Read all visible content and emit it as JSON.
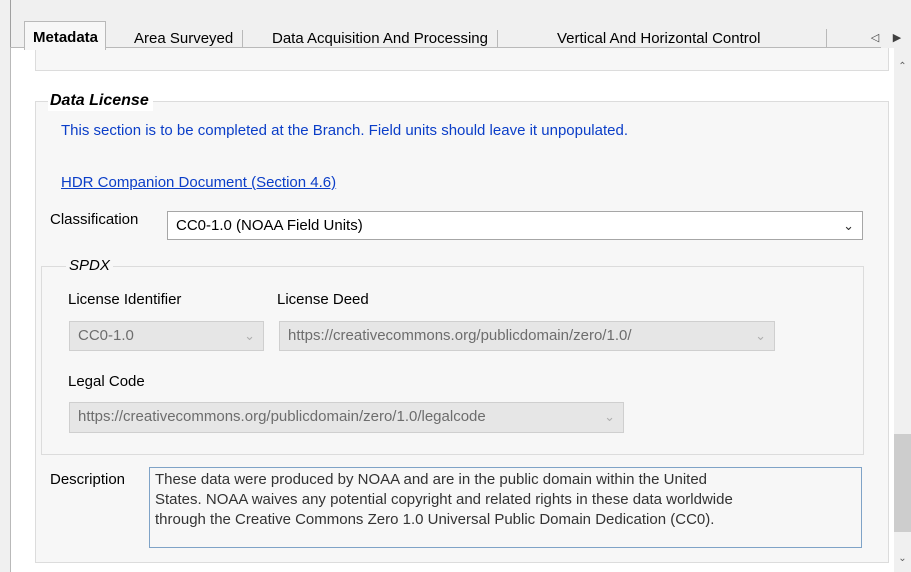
{
  "tabs": [
    {
      "label": "Metadata",
      "active": true
    },
    {
      "label": "Area Surveyed",
      "active": false
    },
    {
      "label": "Data Acquisition And Processing",
      "active": false
    },
    {
      "label": "Vertical And Horizontal Control",
      "active": false
    }
  ],
  "tab_scroll": {
    "left_icon": "triangle-left-icon",
    "right_icon": "triangle-right-icon"
  },
  "data_license": {
    "title": "Data License",
    "note": "This section is to be completed at the Branch. Field units should leave it unpopulated.",
    "link": "HDR Companion Document (Section 4.6)",
    "classification_label": "Classification",
    "classification_value": "CC0-1.0 (NOAA Field Units)",
    "spdx": {
      "title": "SPDX",
      "license_identifier_label": "License Identifier",
      "license_identifier_value": "CC0-1.0",
      "license_deed_label": "License Deed",
      "license_deed_value": "https://creativecommons.org/publicdomain/zero/1.0/",
      "legal_code_label": "Legal Code",
      "legal_code_value": "https://creativecommons.org/publicdomain/zero/1.0/legalcode"
    },
    "description_label": "Description",
    "description_lines": [
      "These data were produced by NOAA and are in the public domain within the United",
      "States. NOAA waives any potential copyright and related rights in these data worldwide",
      "through the Creative Commons Zero 1.0 Universal Public Domain Dedication (CC0)."
    ]
  },
  "colors": {
    "link": "#0b3ec8",
    "group_bg": "#f7f7f7",
    "field_border": "#7fa3c7"
  }
}
